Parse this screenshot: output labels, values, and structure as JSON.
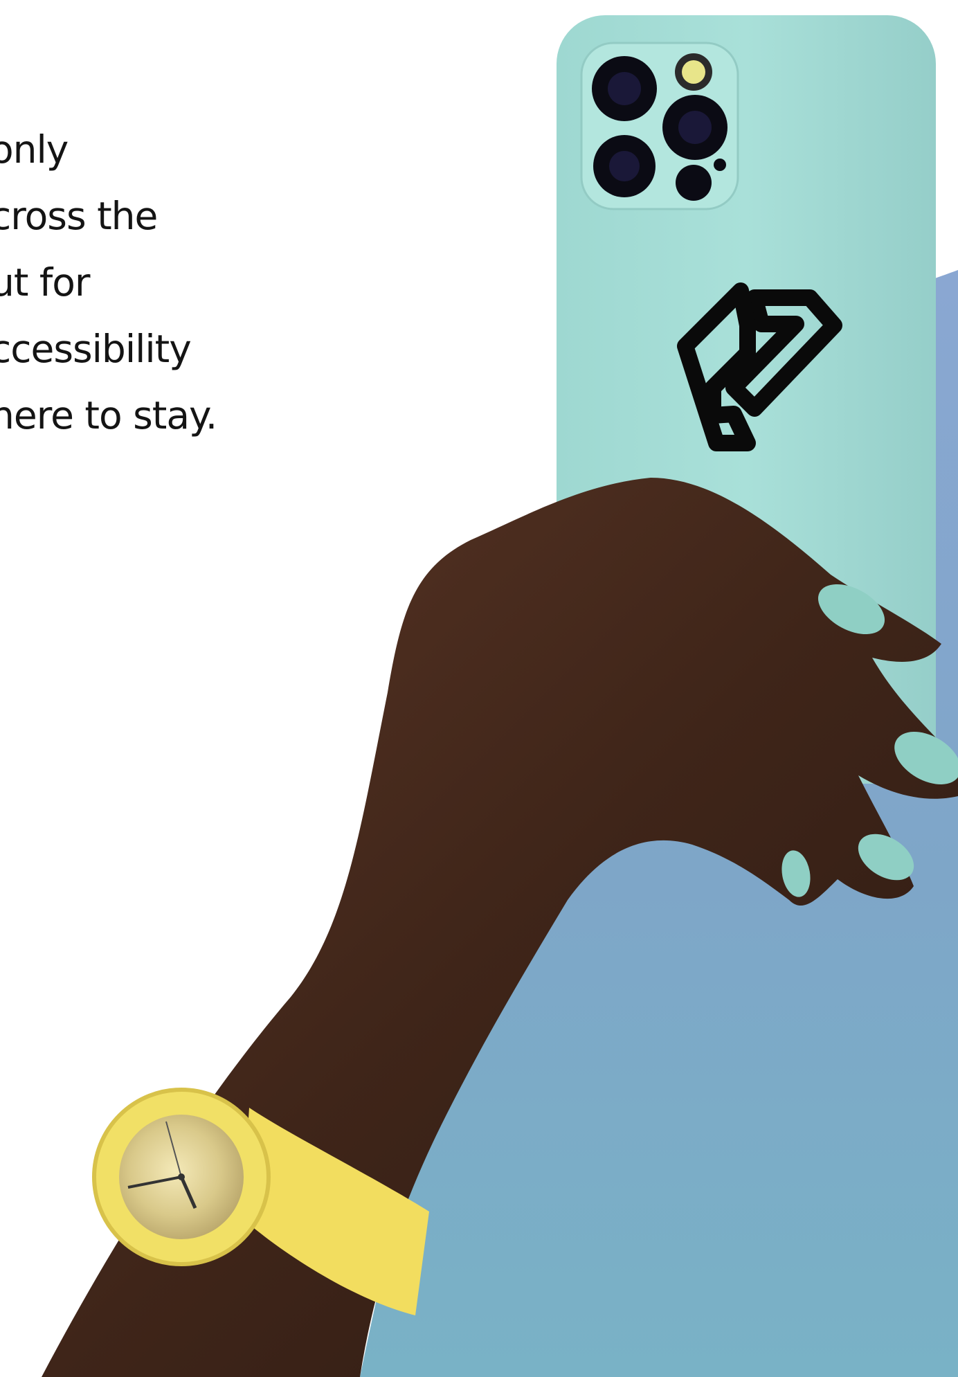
{
  "hero": {
    "text_lines": [
      "only",
      "cross the",
      "ut for",
      "ccessibility",
      "here to stay."
    ]
  },
  "photo": {
    "phone_logo_icon": "link-chain-icon",
    "colors": {
      "background_shape": "#7fa6cc",
      "phone_case": "#a5ddd6",
      "skin": "#4a2c1d",
      "watch": "#f4e36a",
      "logo": "#0a0a0a"
    }
  }
}
